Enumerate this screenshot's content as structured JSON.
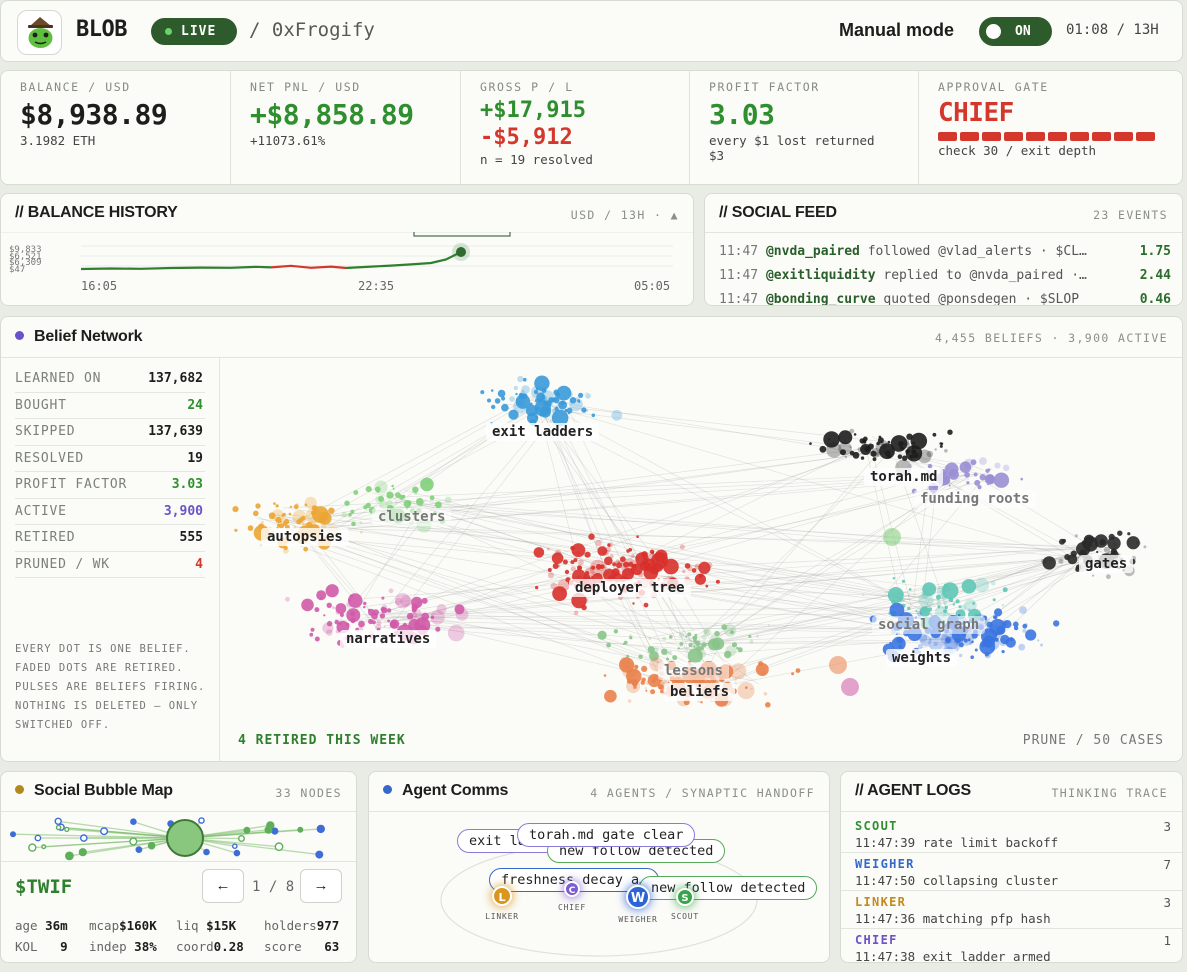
{
  "header": {
    "brand": "BLOB",
    "live": "LIVE",
    "wallet": "/ 0xFrogify",
    "mode_label": "Manual mode",
    "mode_state": "ON",
    "clock": "01:08 / 13H"
  },
  "stats": {
    "balance": {
      "label": "BALANCE / USD",
      "value": "$8,938.89",
      "sub": "3.1982 ETH"
    },
    "net_pnl": {
      "label": "NET PNL / USD",
      "value": "+$8,858.89",
      "sub": "+11073.61%"
    },
    "gross": {
      "label": "GROSS P / L",
      "gain": "+$17,915",
      "loss": "-$5,912",
      "sub": "n = 19 resolved"
    },
    "profit_factor": {
      "label": "PROFIT FACTOR",
      "value": "3.03",
      "sub1": "every $1 lost returned",
      "sub2": "$3"
    },
    "approval": {
      "label": "APPROVAL GATE",
      "value": "CHIEF",
      "sub": "check 30 / exit depth",
      "segments": 10
    }
  },
  "balance_history": {
    "title": "// BALANCE HISTORY",
    "meta": "USD / 13H · ▲",
    "x_ticks": [
      "16:05",
      "22:35",
      "05:05"
    ],
    "y_ticks": [
      "$9,833",
      "$6,521",
      "$6,309",
      "$47"
    ],
    "colors": {
      "up": "#2f7f2f",
      "down": "#d4372c"
    }
  },
  "social_feed": {
    "title": "// SOCIAL FEED",
    "meta": "23 EVENTS",
    "rows": [
      {
        "time": "11:47",
        "user": "@nvda_paired",
        "text": "followed @vlad_alerts · $CL…",
        "value": "1.75"
      },
      {
        "time": "11:47",
        "user": "@exitliquidity",
        "text": "replied to @nvda_paired ·…",
        "value": "2.44"
      },
      {
        "time": "11:47",
        "user": "@bonding_curve",
        "text": "quoted @ponsdegen · $SLOP",
        "value": "0.46"
      }
    ]
  },
  "belief_network": {
    "title": "Belief Network",
    "meta": "4,455 BELIEFS · 3,900 ACTIVE",
    "accent": "#6b52c8",
    "metrics": [
      {
        "label": "LEARNED ON",
        "value": "137,682",
        "tone": "default"
      },
      {
        "label": "BOUGHT",
        "value": "24",
        "tone": "green"
      },
      {
        "label": "SKIPPED",
        "value": "137,639",
        "tone": "default"
      },
      {
        "label": "RESOLVED",
        "value": "19",
        "tone": "default"
      },
      {
        "label": "PROFIT FACTOR",
        "value": "3.03",
        "tone": "green"
      },
      {
        "label": "ACTIVE",
        "value": "3,900",
        "tone": "purple"
      },
      {
        "label": "RETIRED",
        "value": "555",
        "tone": "default"
      },
      {
        "label": "PRUNED / WK",
        "value": "4",
        "tone": "red"
      }
    ],
    "note": "EVERY DOT IS ONE BELIEF. FADED DOTS ARE RETIRED. PULSES ARE BELIEFS FIRING. NOTHING IS DELETED — ONLY SWITCHED OFF.",
    "footer_left": "4 RETIRED THIS WEEK",
    "footer_right": "PRUNE / 50 CASES",
    "clusters": {
      "exit_ladders": "exit ladders",
      "torah": "torah.md",
      "funding_roots": "funding roots",
      "clusters": "clusters",
      "autopsies": "autopsies",
      "deployer_tree": "deployer tree",
      "gates": "gates",
      "social_graph": "social graph",
      "weights": "weights",
      "narratives": "narratives",
      "lessons": "lessons",
      "beliefs": "beliefs"
    },
    "cluster_colors": {
      "exit_ladders": "#3a9ad9",
      "torah": "#1d1d1d",
      "funding_roots": "#9a8fd4",
      "clusters": "#7fcf7a",
      "autopsies": "#eba533",
      "deployer_tree": "#d8302b",
      "gates": "#2a2a2a",
      "social_graph": "#5fc7b5",
      "weights": "#3b74e0",
      "narratives": "#d05aa8",
      "lessons": "#88c48a",
      "beliefs": "#e9814a"
    }
  },
  "social_bubble": {
    "title": "Social Bubble Map",
    "meta": "33 NODES",
    "accent": "#b08a1e",
    "ticker": "$TWIF",
    "prev": "←",
    "next": "→",
    "page": "1 / 8",
    "metrics_row1": [
      {
        "k": "age",
        "v": "36m"
      },
      {
        "k": "mcap",
        "v": "$160K"
      },
      {
        "k": "liq",
        "v": "$15K"
      },
      {
        "k": "holders",
        "v": "977"
      }
    ],
    "metrics_row2": [
      {
        "k": "KOL",
        "v": "9"
      },
      {
        "k": "indep",
        "v": "38%"
      },
      {
        "k": "coord",
        "v": "0.28"
      },
      {
        "k": "score",
        "v": "63"
      }
    ]
  },
  "agent_comms": {
    "title": "Agent Comms",
    "meta": "4 AGENTS / SYNAPTIC HANDOFF",
    "accent": "#3568c8",
    "bubbles": [
      {
        "text": "exit ladder armed",
        "color": "#8d7ad8"
      },
      {
        "text": "torah.md gate clear",
        "color": "#8d7ad8"
      },
      {
        "text": "new follow detected",
        "color": "#57a85a"
      },
      {
        "text": "freshness decay a…",
        "color": "#3568c8"
      },
      {
        "text": "new follow detected",
        "color": "#57a85a"
      }
    ],
    "agents": [
      {
        "letter": "L",
        "name": "LINKER",
        "color": "#d9971f"
      },
      {
        "letter": "C",
        "name": "CHIEF",
        "color": "#7d5cd0"
      },
      {
        "letter": "W",
        "name": "WEIGHER",
        "color": "#2d64d4"
      },
      {
        "letter": "S",
        "name": "SCOUT",
        "color": "#3aa548"
      }
    ]
  },
  "agent_logs": {
    "title": "// AGENT LOGS",
    "meta": "THINKING TRACE",
    "entries": [
      {
        "agent": "SCOUT",
        "count": "3",
        "msg": "11:47:39 rate limit backoff",
        "color": "#2f8f2f"
      },
      {
        "agent": "WEIGHER",
        "count": "7",
        "msg": "11:47:50 collapsing cluster",
        "color": "#3568c8"
      },
      {
        "agent": "LINKER",
        "count": "3",
        "msg": "11:47:36 matching pfp hash",
        "color": "#c48a1a"
      },
      {
        "agent": "CHIEF",
        "count": "1",
        "msg": "11:47:38 exit ladder armed",
        "color": "#6b52c8"
      }
    ]
  }
}
